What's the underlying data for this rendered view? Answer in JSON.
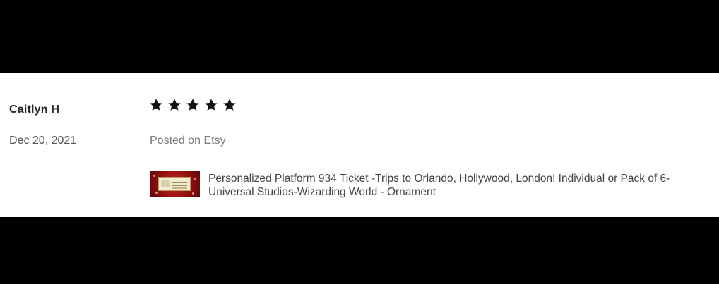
{
  "review": {
    "reviewer_name": "Caitlyn H",
    "date": "Dec 20, 2021",
    "rating": 5,
    "rating_max": 5,
    "source_text": "Posted on Etsy",
    "product": {
      "title": "Personalized Platform 934 Ticket -Trips to Orlando, Hollywood, London! Individual or Pack of 6- Universal Studios-Wizarding World - Ornament",
      "thumbnail_icon": "ticket-ornament-thumbnail"
    }
  },
  "colors": {
    "background": "#000000",
    "card": "#ffffff",
    "star": "#111111",
    "thumb_red": "#b51d1a"
  }
}
